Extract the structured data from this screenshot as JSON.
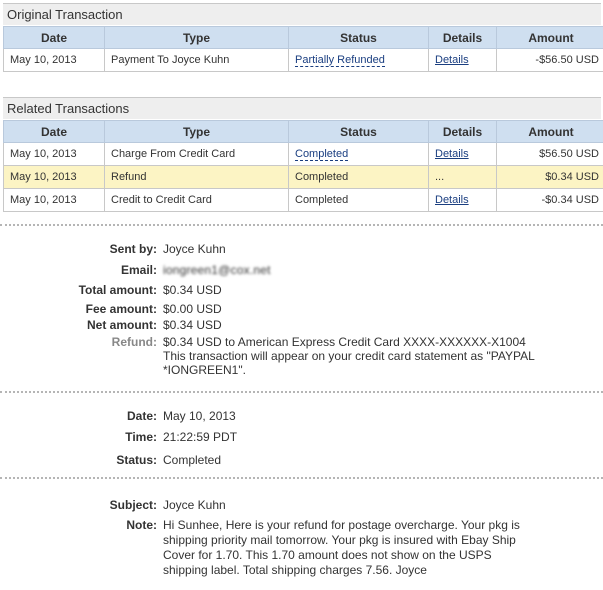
{
  "original": {
    "title": "Original Transaction",
    "headers": [
      "Date",
      "Type",
      "Status",
      "Details",
      "Amount"
    ],
    "rows": [
      {
        "date": "May 10, 2013",
        "type": "Payment To Joyce Kuhn",
        "status": "Partially Refunded",
        "details": "Details",
        "amount": "-$56.50 USD"
      }
    ]
  },
  "related": {
    "title": "Related Transactions",
    "headers": [
      "Date",
      "Type",
      "Status",
      "Details",
      "Amount"
    ],
    "rows": [
      {
        "date": "May 10, 2013",
        "type": "Charge From Credit Card",
        "status": "Completed",
        "details": "Details",
        "amount": "$56.50 USD"
      },
      {
        "date": "May 10, 2013",
        "type": "Refund",
        "status": "Completed",
        "details": "...",
        "amount": "$0.34 USD"
      },
      {
        "date": "May 10, 2013",
        "type": "Credit to Credit Card",
        "status": "Completed",
        "details": "Details",
        "amount": "-$0.34 USD"
      }
    ]
  },
  "details": {
    "sent_by_label": "Sent by:",
    "sent_by": "Joyce Kuhn",
    "email_label": "Email:",
    "email": "iongreen1@cox.net",
    "total_label": "Total amount:",
    "total": "$0.34 USD",
    "fee_label": "Fee amount:",
    "fee": "$0.00 USD",
    "net_label": "Net amount:",
    "net": "$0.34 USD",
    "refund_label": "Refund:",
    "refund_line1": "$0.34 USD to American Express Credit Card XXXX-XXXXXX-X1004",
    "refund_line2": "This transaction will appear on your credit card statement as \"PAYPAL *IONGREEN1\"."
  },
  "timing": {
    "date_label": "Date:",
    "date": "May 10, 2013",
    "time_label": "Time:",
    "time": "21:22:59 PDT",
    "status_label": "Status:",
    "status": "Completed"
  },
  "message": {
    "subject_label": "Subject:",
    "subject": "Joyce Kuhn",
    "note_label": "Note:",
    "note": "Hi Sunhee, Here is your refund for postage overcharge. Your pkg is shipping priority mail tomorrow. Your pkg is insured with Ebay Ship Cover for 1.70. This 1.70 amount does not show on the USPS shipping label. Total shipping charges 7.56. Joyce"
  }
}
